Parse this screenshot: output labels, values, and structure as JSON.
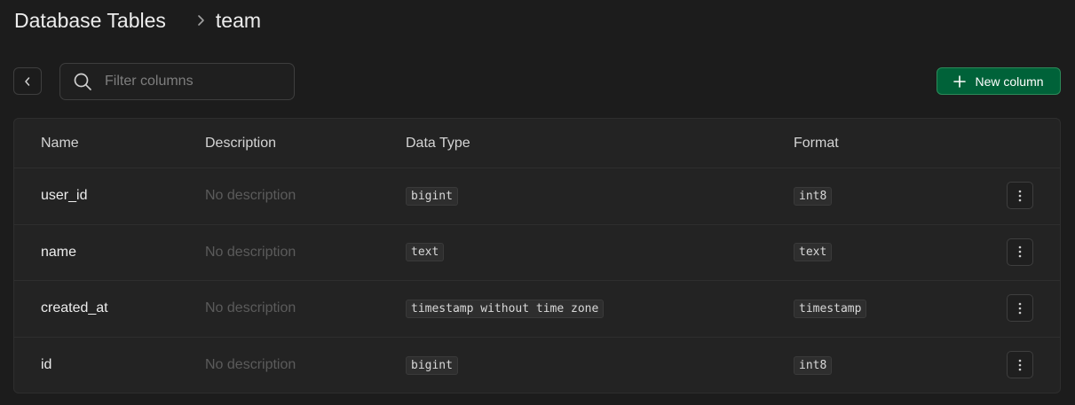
{
  "breadcrumb": {
    "root": "Database Tables",
    "current": "team"
  },
  "toolbar": {
    "search_placeholder": "Filter columns",
    "search_value": "",
    "new_column_label": "New column"
  },
  "table": {
    "headers": {
      "name": "Name",
      "description": "Description",
      "data_type": "Data Type",
      "format": "Format"
    },
    "rows": [
      {
        "name": "user_id",
        "description": "No description",
        "data_type": "bigint",
        "format": "int8"
      },
      {
        "name": "name",
        "description": "No description",
        "data_type": "text",
        "format": "text"
      },
      {
        "name": "created_at",
        "description": "No description",
        "data_type": "timestamp without time zone",
        "format": "timestamp"
      },
      {
        "name": "id",
        "description": "No description",
        "data_type": "bigint",
        "format": "int8"
      }
    ]
  },
  "icons": {
    "breadcrumb_separator": "chevron-right-icon",
    "back": "chevron-left-icon",
    "search": "search-icon",
    "add": "plus-icon",
    "row_menu": "more-vertical-icon"
  },
  "colors": {
    "background": "#1c1c1c",
    "accent": "#006239",
    "accent_border": "#2c8a59"
  }
}
